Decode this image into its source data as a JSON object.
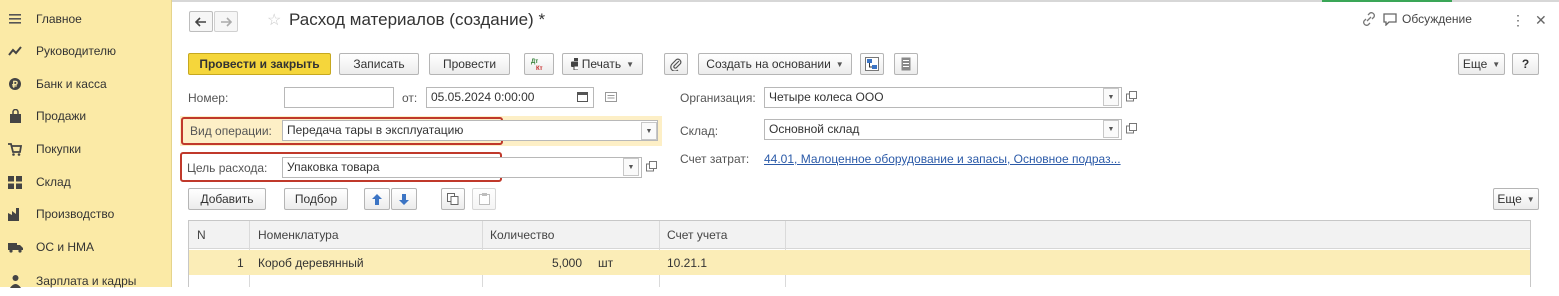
{
  "sidebar": {
    "items": [
      {
        "label": "Главное",
        "icon": "menu-lines-icon"
      },
      {
        "label": "Руководителю",
        "icon": "trend-chart-icon"
      },
      {
        "label": "Банк и касса",
        "icon": "coins-icon"
      },
      {
        "label": "Продажи",
        "icon": "shopping-bag-icon"
      },
      {
        "label": "Покупки",
        "icon": "cart-icon"
      },
      {
        "label": "Склад",
        "icon": "warehouse-icon"
      },
      {
        "label": "Производство",
        "icon": "factory-icon"
      },
      {
        "label": "ОС и НМА",
        "icon": "truck-icon"
      },
      {
        "label": "Зарплата и кадры",
        "icon": "person-icon"
      }
    ]
  },
  "header": {
    "title": "Расход материалов (создание) *",
    "discussion_label": "Обсуждение"
  },
  "toolbar": {
    "post_close": "Провести и закрыть",
    "save": "Записать",
    "post": "Провести",
    "dt_kt": "Дт Кт",
    "print": "Печать",
    "create_based": "Создать на основании",
    "more": "Еще",
    "help": "?"
  },
  "form": {
    "number_label": "Номер:",
    "number_value": "",
    "from_label": "от:",
    "date_value": "05.05.2024  0:00:00",
    "organization_label": "Организация:",
    "organization_value": "Четыре колеса ООО",
    "operation_label": "Вид операции:",
    "operation_value": "Передача тары в эксплуатацию",
    "warehouse_label": "Склад:",
    "warehouse_value": "Основной склад",
    "purpose_label": "Цель расхода:",
    "purpose_value": "Упаковка товара",
    "cost_account_label": "Счет затрат:",
    "cost_account_value": "44.01, Малоценное оборудование и запасы, Основное подраз..."
  },
  "table_toolbar": {
    "add": "Добавить",
    "select": "Подбор",
    "more": "Еще"
  },
  "table": {
    "columns": [
      "N",
      "Номенклатура",
      "Количество",
      "Счет учета"
    ],
    "rows": [
      {
        "n": "1",
        "item": "Короб деревянный",
        "qty": "5,000",
        "unit": "шт",
        "account": "10.21.1"
      }
    ]
  },
  "colors": {
    "sidebar_bg": "#fbeaa6",
    "primary_button": "#f5d63b",
    "highlight_frame": "#c0392b",
    "link": "#2b5aa8"
  }
}
